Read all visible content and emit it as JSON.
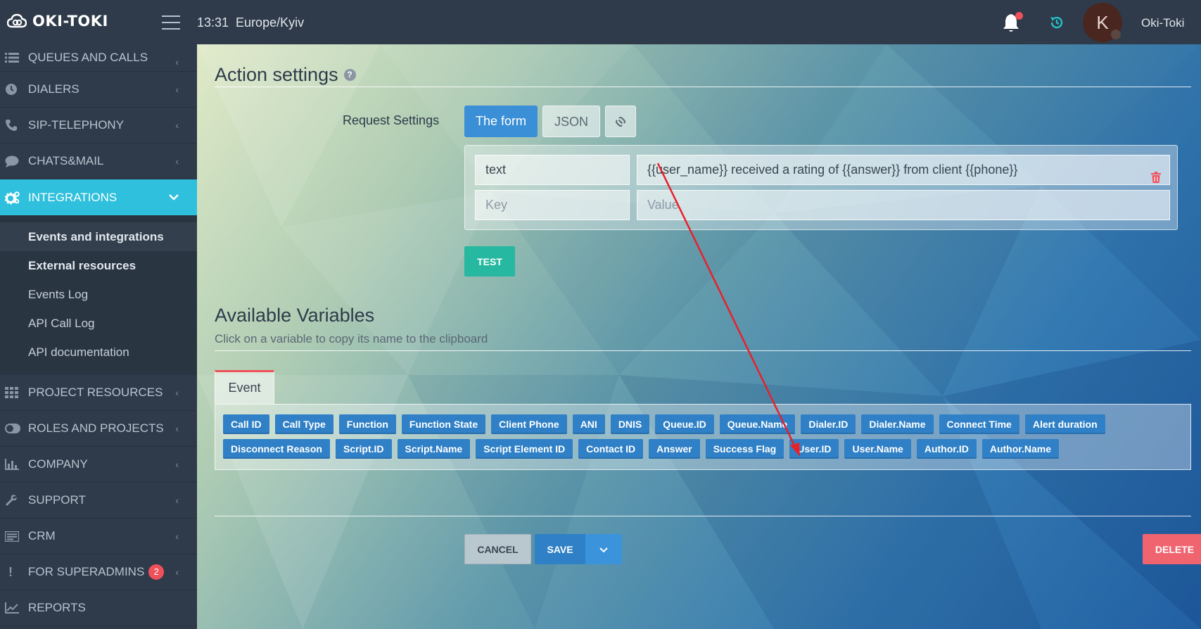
{
  "header": {
    "logo_text": "OKI-TOKI",
    "time": "13:31",
    "timezone": "Europe/Kyiv",
    "avatar_letter": "K",
    "username": "Oki-Toki"
  },
  "sidebar": {
    "items": [
      {
        "label": "QUEUES AND CALLS",
        "icon": "list-icon"
      },
      {
        "label": "DIALERS",
        "icon": "clock-icon"
      },
      {
        "label": "SIP-TELEPHONY",
        "icon": "phone-icon"
      },
      {
        "label": "CHATS&MAIL",
        "icon": "chat-icon"
      },
      {
        "label": "INTEGRATIONS",
        "icon": "gears-icon",
        "active": true
      },
      {
        "label": "PROJECT RESOURCES",
        "icon": "grid-icon"
      },
      {
        "label": "ROLES AND PROJECTS",
        "icon": "toggle-icon"
      },
      {
        "label": "COMPANY",
        "icon": "bar-chart-icon"
      },
      {
        "label": "SUPPORT",
        "icon": "wrench-icon"
      },
      {
        "label": "CRM",
        "icon": "card-icon"
      },
      {
        "label": "FOR SUPERADMINS",
        "icon": "exclamation-icon",
        "badge": "2"
      },
      {
        "label": "REPORTS",
        "icon": "line-chart-icon"
      }
    ],
    "submenu": [
      {
        "label": "Events and integrations",
        "bold": true
      },
      {
        "label": "External resources",
        "bold": true
      },
      {
        "label": "Events Log"
      },
      {
        "label": "API Call Log"
      },
      {
        "label": "API documentation"
      }
    ]
  },
  "action_settings": {
    "title": "Action settings",
    "help": "?",
    "request_settings_label": "Request Settings",
    "tabs": {
      "form": "The form",
      "json": "JSON"
    },
    "rows": [
      {
        "key": "text",
        "value": "{{user_name}} received a rating of {{answer}} from client {{phone}}"
      }
    ],
    "new_row": {
      "key_placeholder": "Key",
      "value_placeholder": "Value"
    },
    "test_label": "TEST"
  },
  "variables": {
    "title": "Available Variables",
    "subtitle": "Click on a variable to copy its name to the clipboard",
    "tab_label": "Event",
    "chips": [
      "Call ID",
      "Call Type",
      "Function",
      "Function State",
      "Client Phone",
      "ANI",
      "DNIS",
      "Queue.ID",
      "Queue.Name",
      "Dialer.ID",
      "Dialer.Name",
      "Connect Time",
      "Alert duration",
      "Disconnect Reason",
      "Script.ID",
      "Script.Name",
      "Script Element ID",
      "Contact ID",
      "Answer",
      "Success Flag",
      "User.ID",
      "User.Name",
      "Author.ID",
      "Author.Name"
    ]
  },
  "footer": {
    "cancel": "CANCEL",
    "save": "SAVE",
    "delete": "DELETE"
  },
  "colors": {
    "primary": "#2f80c6",
    "accent_cyan": "#2ec0dc",
    "test_green": "#26b8a0",
    "danger": "#f06470",
    "arrow_red": "#e8202a"
  }
}
